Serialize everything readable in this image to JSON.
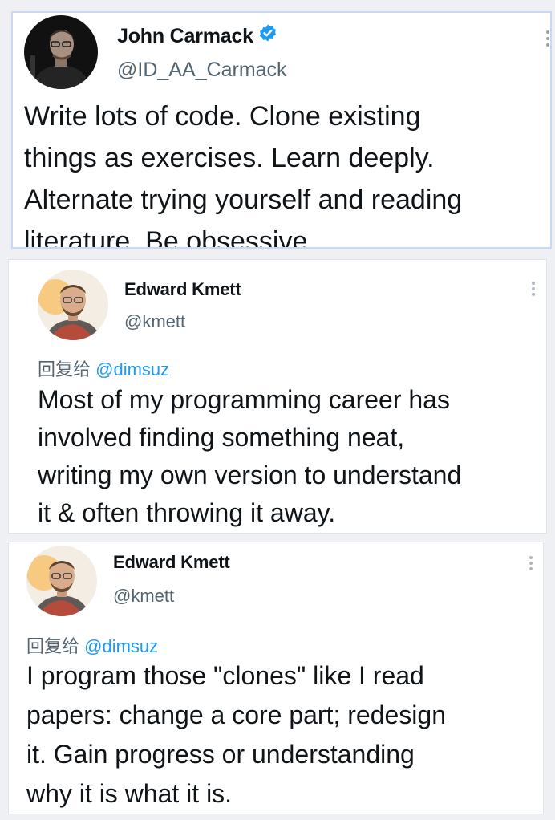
{
  "tweets": [
    {
      "name": "John Carmack",
      "handle": "@ID_AA_Carmack",
      "verified": true,
      "text": "Write lots of code. Clone existing\nthings as exercises. Learn deeply.\nAlternate trying yourself and reading\nliterature. Be obsessive"
    },
    {
      "name": "Edward Kmett",
      "handle": "@kmett",
      "reply_prefix": "回复给",
      "reply_to": "@dimsuz",
      "text": "Most of my programming career has\ninvolved finding something neat,\nwriting my own version to understand\nit & often throwing it away."
    },
    {
      "name": "Edward Kmett",
      "handle": "@kmett",
      "reply_prefix": "回复给",
      "reply_to": "@dimsuz",
      "text": "I program those \"clones\" like I read\npapers: change a core part; redesign\nit. Gain progress or understanding\nwhy it is what it is."
    }
  ],
  "colors": {
    "verified_badge": "#1d9bf0",
    "mention": "#1d9bf0",
    "handle": "#536471"
  },
  "icons": {
    "verified": "verified-badge-icon",
    "more": "more-options-icon"
  }
}
